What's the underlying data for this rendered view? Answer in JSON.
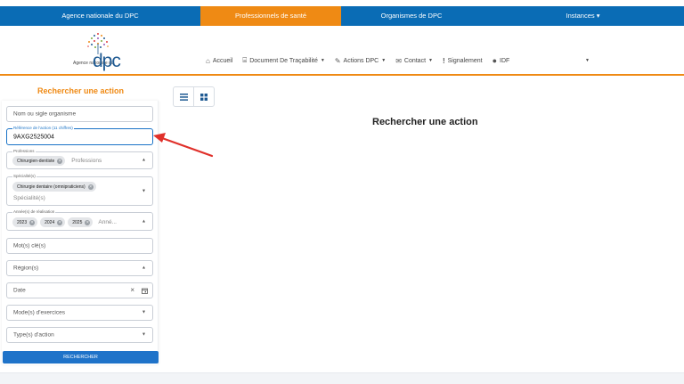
{
  "topnav": [
    {
      "label": "Agence nationale du DPC",
      "active": false
    },
    {
      "label": "Professionnels de santé",
      "active": true
    },
    {
      "label": "Organismes de DPC",
      "active": false
    },
    {
      "label": "Instances ▾",
      "active": false
    }
  ],
  "logo": {
    "agence": "Agence nationale du",
    "dpc": "dpc"
  },
  "nav": {
    "accueil": "Accueil",
    "tracabilite": "Document De Traçabilité",
    "actions": "Actions DPC",
    "contact": "Contact",
    "signalement": "Signalement",
    "user": "IDF"
  },
  "sidebar": {
    "title": "Rechercher une action",
    "org_placeholder": "Nom ou sigle organisme",
    "ref_label": "Référence de l'action (11 chiffres)",
    "ref_value": "9AXG2525004",
    "professions": {
      "label": "Professions",
      "chips": [
        "Chirurgien-dentiste"
      ],
      "placeholder": "Professions"
    },
    "specialites": {
      "label": "Spécialité(s)",
      "chips": [
        "Chirurgie dentaire (omnipraticiens)"
      ],
      "placeholder": "Spécialité(s)"
    },
    "annees": {
      "label": "Année(s) de réalisation",
      "chips": [
        "2023",
        "2024",
        "2025"
      ],
      "placeholder": "Anné..."
    },
    "motscles_placeholder": "Mot(s) clé(s)",
    "region_placeholder": "Région(s)",
    "date_placeholder": "Date",
    "modes_placeholder": "Mode(s) d'exercices",
    "types_placeholder": "Type(s) d'action",
    "submit": "RECHERCHER"
  },
  "main": {
    "title": "Rechercher une action"
  },
  "colors": {
    "primary_blue": "#0a6cb5",
    "active_orange": "#ef8a14",
    "button_blue": "#1f73c9",
    "annotation_red": "#e0302a"
  }
}
